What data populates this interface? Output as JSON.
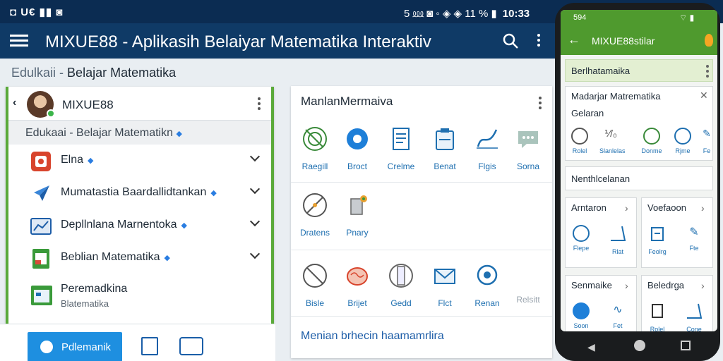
{
  "statusbar": {
    "left": "◘ U€ ▮▮ ◙",
    "right": "5 ⅏ ◙ ◦ ◈ ◈ 11 % ▮",
    "time": "10:33"
  },
  "appbar": {
    "title": "MIXUE88 - Aplikasih Belaiyar Matematika Interaktiv"
  },
  "breadcrumb": {
    "first": "Edulkaii -",
    "second": "Belajar Matematika"
  },
  "sidebar": {
    "user": "MIXUE88",
    "subtitle": "Edukaai - Belajar Matematikn",
    "items": [
      {
        "label": "Elna",
        "icon": "lock-icon"
      },
      {
        "label": "Mumatastia Baardallidtankan",
        "icon": "compass-arrow-icon"
      },
      {
        "label": "Depllnlana Marnentoka",
        "icon": "chart-window-icon"
      },
      {
        "label": "Beblian Matematika",
        "icon": "spreadsheet-icon"
      }
    ],
    "last": {
      "title": "Peremadkina",
      "subtitle": "Blatematika"
    }
  },
  "bottombar": {
    "primary": "Pdlemanik"
  },
  "main": {
    "title": "ManlanMermaiva",
    "row1": [
      "Raegill",
      "Broct",
      "Crelme",
      "Benat",
      "Flgis",
      "Sorna"
    ],
    "row2": [
      "Dratens",
      "Pnary"
    ],
    "row3": [
      "Bisle",
      "Brijet",
      "Gedd",
      "Flct",
      "Renan",
      "Relsitt"
    ],
    "footer": "Menian brhecin haamamrlira"
  },
  "phone": {
    "status_time": "594",
    "title": "MIXUE88stilar",
    "tab": "Berlhatamaika",
    "card1": {
      "title": "Madarjar Matrematika",
      "subtitle": "Gelaran",
      "items": [
        "Rolel",
        "Slanlelas",
        "Donme",
        "Rjme",
        "Fe"
      ]
    },
    "card2": {
      "title": "Nenthlcelanan"
    },
    "card3": {
      "title": "Arntaron",
      "items": [
        "Flepe",
        "Rlat"
      ]
    },
    "card4": {
      "title": "Voefaoon",
      "items": [
        "Feolrg",
        "Fte"
      ]
    },
    "card5": {
      "title": "Senmaike",
      "items": [
        "Soon",
        "Fet"
      ]
    },
    "card6": {
      "title": "Beledrga",
      "items": [
        "Rolel",
        "Cone"
      ]
    }
  },
  "colors": {
    "appbar": "#0f3a66",
    "statusbar": "#0b2c52",
    "accent_green": "#5aaa3a",
    "primary_blue": "#1e8fe0"
  }
}
